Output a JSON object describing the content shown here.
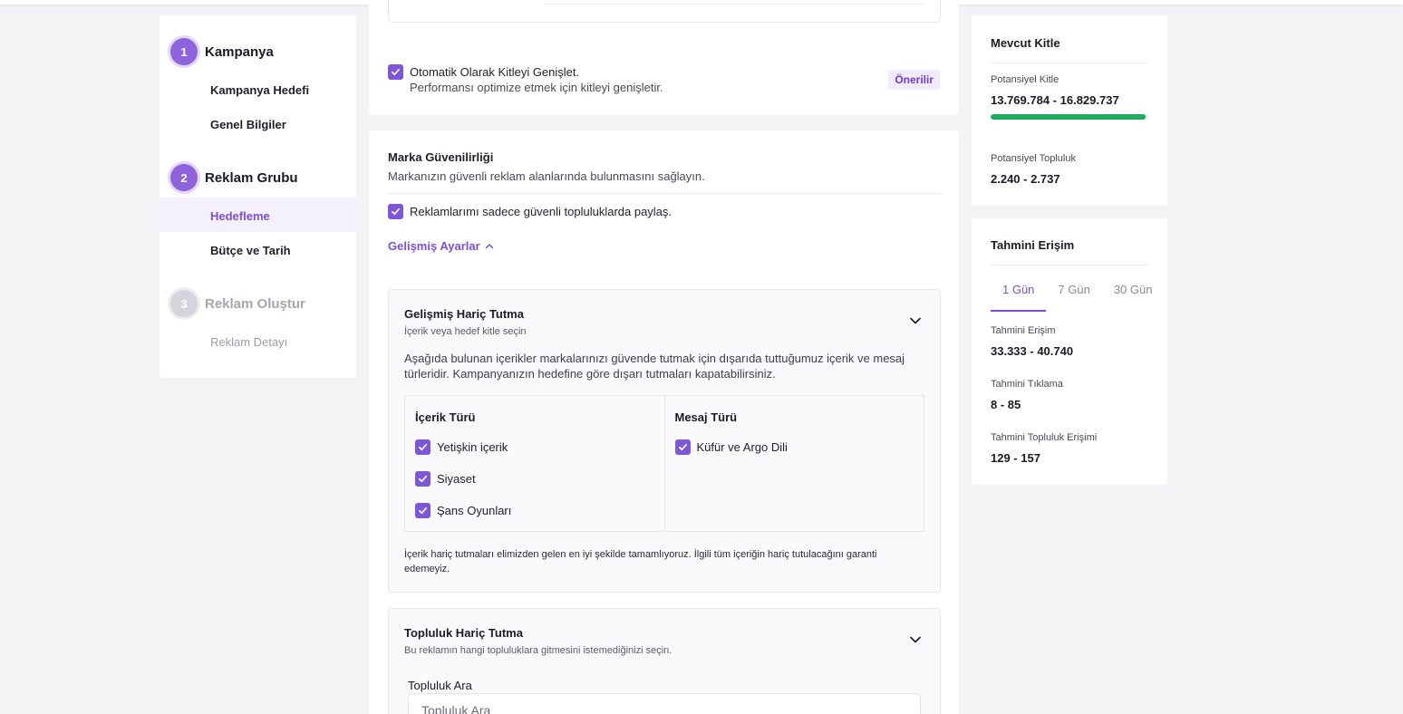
{
  "stepper": {
    "steps": [
      {
        "num": "1",
        "title": "Kampanya",
        "substeps": [
          "Kampanya Hedefi",
          "Genel Bilgiler"
        ]
      },
      {
        "num": "2",
        "title": "Reklam Grubu",
        "substeps": [
          "Hedefleme",
          "Bütçe ve Tarih"
        ]
      },
      {
        "num": "3",
        "title": "Reklam Oluştur",
        "substeps": [
          "Reklam Detayı"
        ]
      }
    ]
  },
  "expand": {
    "label": "Otomatik Olarak Kitleyi Genişlet.",
    "description": "Performansı optimize etmek için kitleyi genişletir.",
    "badge": "Önerilir"
  },
  "brand_safety": {
    "title": "Marka Güvenilirliği",
    "subtitle": "Markanızın güvenli reklam alanlarında bulunmasını sağlayın.",
    "checkbox_label": "Reklamlarımı sadece güvenli topluluklarda paylaş.",
    "advanced_link": "Gelişmiş Ayarlar"
  },
  "advanced_exclusion": {
    "title": "Gelişmiş Hariç Tutma",
    "subtitle": "İçerik veya hedef kitle seçin",
    "description": "Aşağıda bulunan içerikler markalarınızı güvende tutmak için dışarıda tuttuğumuz içerik ve mesaj türleridir. Kampanyanızın hedefine göre dışarı tutmaları kapatabilirsiniz.",
    "content_type_header": "İçerik Türü",
    "content_types": [
      "Yetişkin içerik",
      "Siyaset",
      "Şans Oyunları"
    ],
    "message_type_header": "Mesaj Türü",
    "message_types": [
      "Küfür ve Argo Dili"
    ],
    "note": "İçerik hariç tutmaları elimizden gelen en iyi şekilde tamamlıyoruz. İlgili tüm içeriğin hariç tutulacağını garanti edemeyiz."
  },
  "community_exclusion": {
    "title": "Topluluk Hariç Tutma",
    "subtitle": "Bu reklamın hangi topluluklara gitmesini istemediğinizi seçin.",
    "field_label": "Topluluk Ara",
    "field_placeholder": "Topluluk Ara"
  },
  "audience": {
    "title": "Mevcut Kitle",
    "potential_label": "Potansiyel Kitle",
    "potential_value": "13.769.784 - 16.829.737",
    "potential_progress": 0.98,
    "community_label": "Potansiyel Topluluk",
    "community_value": "2.240 - 2.737"
  },
  "reach": {
    "title": "Tahmini Erişim",
    "tabs": [
      "1 Gün",
      "7 Gün",
      "30 Gün"
    ],
    "active_tab": "1 Gün",
    "reach_label": "Tahmini Erişim",
    "reach_value": "33.333 - 40.740",
    "clicks_label": "Tahmini Tıklama",
    "clicks_value": "8 - 85",
    "community_reach_label": "Tahmini Topluluk Erişimi",
    "community_reach_value": "129 - 157"
  },
  "colors": {
    "accent": "#7c4fd6",
    "progress": "#1fab5e"
  }
}
